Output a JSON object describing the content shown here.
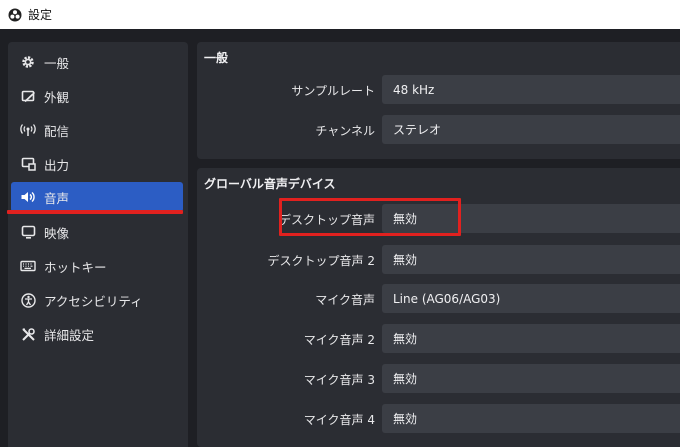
{
  "window": {
    "title": "設定"
  },
  "sidebar": {
    "items": [
      {
        "label": "一般",
        "icon": "gear-icon"
      },
      {
        "label": "外観",
        "icon": "appearance-icon"
      },
      {
        "label": "配信",
        "icon": "broadcast-icon"
      },
      {
        "label": "出力",
        "icon": "output-icon"
      },
      {
        "label": "音声",
        "icon": "speaker-icon",
        "active": true
      },
      {
        "label": "映像",
        "icon": "monitor-icon"
      },
      {
        "label": "ホットキー",
        "icon": "keyboard-icon"
      },
      {
        "label": "アクセシビリティ",
        "icon": "accessibility-icon"
      },
      {
        "label": "詳細設定",
        "icon": "tools-icon"
      }
    ],
    "active_color": "#2c5dc4"
  },
  "general": {
    "title": "一般",
    "sample_rate": {
      "label": "サンプルレート",
      "value": "48 kHz"
    },
    "channels": {
      "label": "チャンネル",
      "value": "ステレオ"
    }
  },
  "global_audio": {
    "title": "グローバル音声デバイス",
    "devices": [
      {
        "label": "デスクトップ音声",
        "value": "無効"
      },
      {
        "label": "デスクトップ音声 2",
        "value": "無効"
      },
      {
        "label": "マイク音声",
        "value": "Line (AG06/AG03)"
      },
      {
        "label": "マイク音声 2",
        "value": "無効"
      },
      {
        "label": "マイク音声 3",
        "value": "無効"
      },
      {
        "label": "マイク音声 4",
        "value": "無効"
      }
    ]
  },
  "annotation_color": "#e1211f"
}
